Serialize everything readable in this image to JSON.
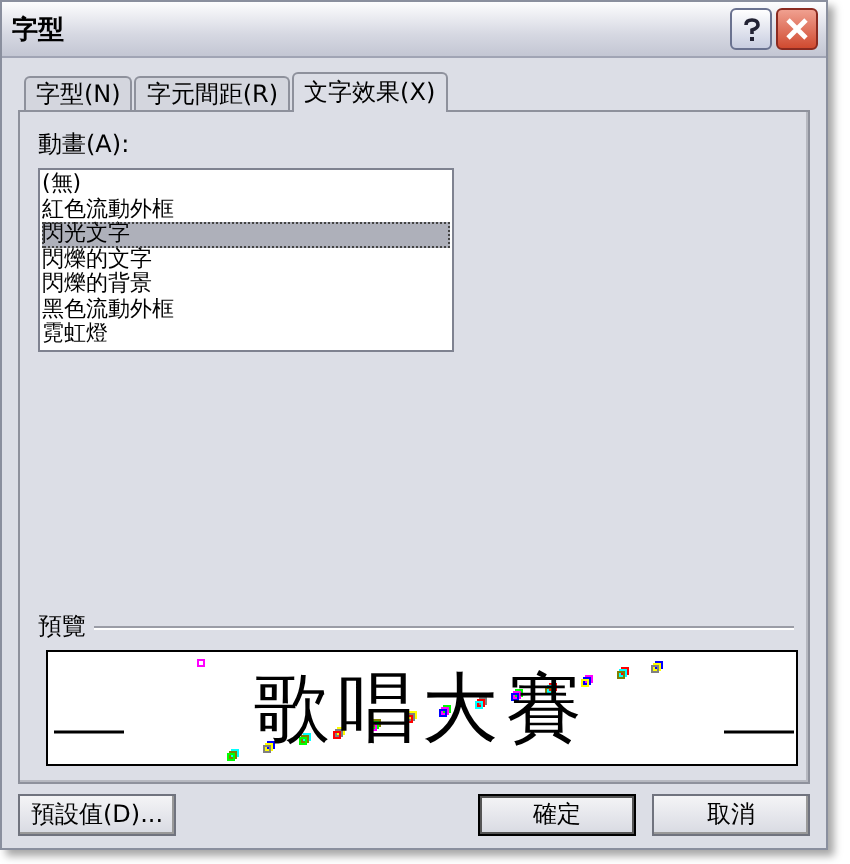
{
  "window": {
    "title": "字型"
  },
  "tabs": [
    {
      "label": "字型(N)",
      "selected": false
    },
    {
      "label": "字元間距(R)",
      "selected": false
    },
    {
      "label": "文字效果(X)",
      "selected": true
    }
  ],
  "animation": {
    "label": "動畫(A):",
    "items": [
      {
        "label": "(無)",
        "selected": false
      },
      {
        "label": "紅色流動外框",
        "selected": false
      },
      {
        "label": "閃光文字",
        "selected": true
      },
      {
        "label": "閃爍的文字",
        "selected": false
      },
      {
        "label": "閃爍的背景",
        "selected": false
      },
      {
        "label": "黑色流動外框",
        "selected": false
      },
      {
        "label": "霓虹燈",
        "selected": false
      }
    ]
  },
  "preview": {
    "label": "預覽",
    "text": "歌唱大賽"
  },
  "buttons": [
    {
      "label": "預設值(D)...",
      "default": false
    },
    {
      "label": "確定",
      "default": true
    },
    {
      "label": "取消",
      "default": false
    }
  ]
}
